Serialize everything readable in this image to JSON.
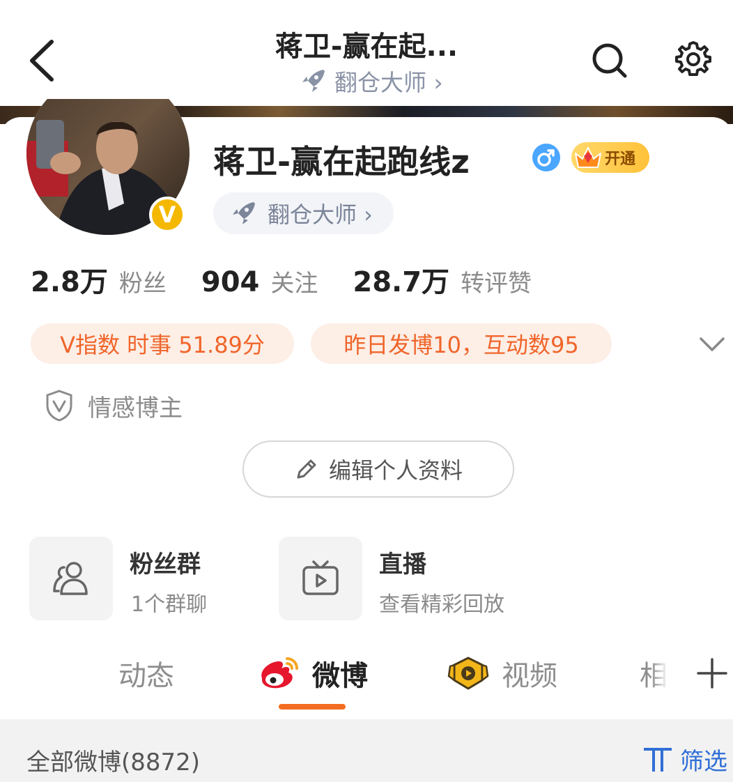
{
  "nav": {
    "title": "蒋卫-赢在起...",
    "subtitle": "翻仓大师 ›",
    "back_icon": "chevron-left-icon",
    "search_icon": "search-icon",
    "settings_icon": "gear-icon"
  },
  "profile": {
    "name": "蒋卫-赢在起跑线z",
    "gender_icon": "male-icon",
    "vip_label": "开通",
    "verified_badge": "V",
    "tag": "翻仓大师 ›"
  },
  "stats": [
    {
      "value": "2.8万",
      "label": "粉丝"
    },
    {
      "value": "904",
      "label": "关注"
    },
    {
      "value": "28.7万",
      "label": "转评赞"
    }
  ],
  "pills": {
    "v_index": "V指数 时事 51.89分",
    "activity": "昨日发博10，互动数95"
  },
  "role": "情感博主",
  "edit_button": "编辑个人资料",
  "features": [
    {
      "title": "粉丝群",
      "subtitle": "1个群聊",
      "icon": "people-icon"
    },
    {
      "title": "直播",
      "subtitle": "查看精彩回放",
      "icon": "tv-play-icon"
    }
  ],
  "tabs": [
    {
      "label": "动态"
    },
    {
      "label": "微博"
    },
    {
      "label": "视频"
    },
    {
      "label": "相"
    }
  ],
  "filter_bar": {
    "all_label": "全部微博(8872)",
    "filter_label": "筛选"
  },
  "colors": {
    "accent": "#f36d21",
    "pill_bg": "#fdeee6",
    "pill_text": "#f0652a",
    "link_blue": "#2f6fd6"
  }
}
